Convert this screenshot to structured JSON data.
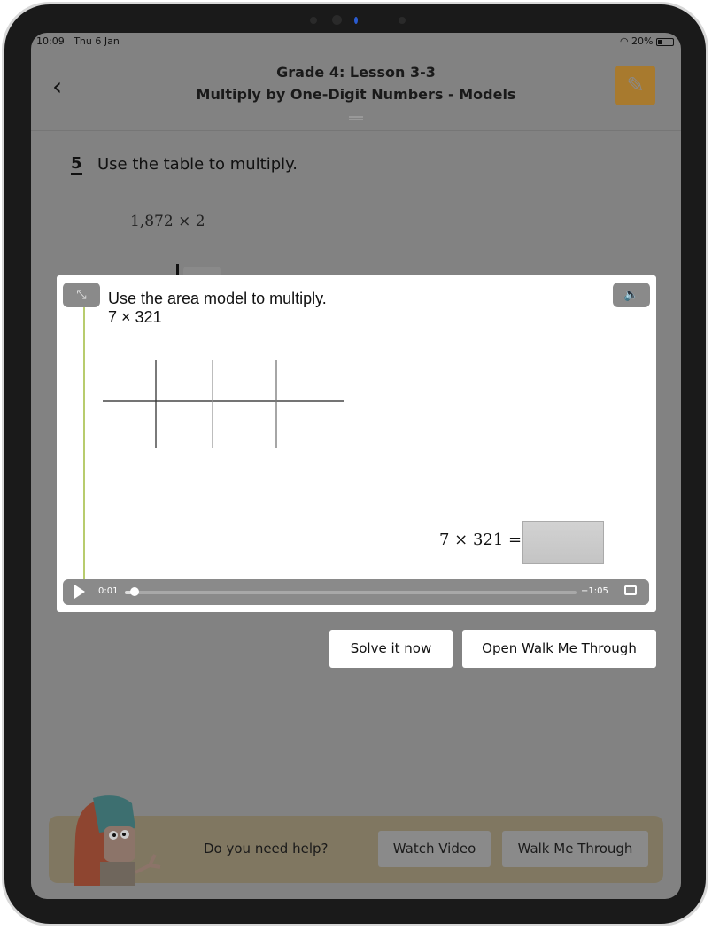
{
  "status": {
    "time": "10:09",
    "date": "Thu 6 Jan",
    "battery": "20%",
    "battery_level": 20
  },
  "header": {
    "title": "Grade 4: Lesson 3-3",
    "subtitle": "Multiply by One-Digit Numbers - Models",
    "back_icon": "chevron-left-icon",
    "notes_icon": "notes-edit-icon",
    "accent": "#a87a2e"
  },
  "question": {
    "number": "5",
    "prompt": "Use the table to multiply.",
    "expression": "1,872 × 2"
  },
  "video": {
    "prompt": "Use the area model to multiply.",
    "expression": "7 × 321",
    "equation": "7 × 321 =",
    "current_time": "0:01",
    "remaining_time": "−1:05",
    "progress_percent": 1.5,
    "expand_icon": "expand-icon",
    "volume_icon": "volume-icon",
    "play_icon": "play-icon",
    "airplay_icon": "airplay-icon"
  },
  "actions": {
    "solve": "Solve it now",
    "walk": "Open Walk Me Through"
  },
  "help": {
    "prompt": "Do you need help?",
    "watch": "Watch Video",
    "walk": "Walk Me Through"
  }
}
